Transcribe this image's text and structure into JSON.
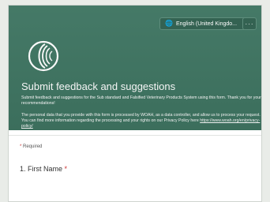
{
  "header": {
    "language_label": "English (United Kingdo...",
    "more_label": "···"
  },
  "form": {
    "title": "Submit feedback and suggestions",
    "description": "Submit feedback and suggestions for the Sub standard and Falsified Veterinary Products System using this form. Thank you for your recommendations!",
    "privacy_text": "The personal data that you provide with this form is processed by WOAH, as a data controller, and allow us to process your request. You can find more information regarding the processing and your rights on our Privacy Policy here",
    "privacy_link": "https://www.woah.org/en/privacy-policy/",
    "required_star": "*",
    "required_label": "Required",
    "questions": [
      {
        "label": "1. First Name",
        "required_star": "*"
      }
    ]
  },
  "colors": {
    "banner": "#3f7562",
    "accent_required": "#cc3333"
  },
  "icons": {
    "language": "globe-icon",
    "dropdown": "chevron-down-icon",
    "logo": "woah-logo-icon"
  }
}
